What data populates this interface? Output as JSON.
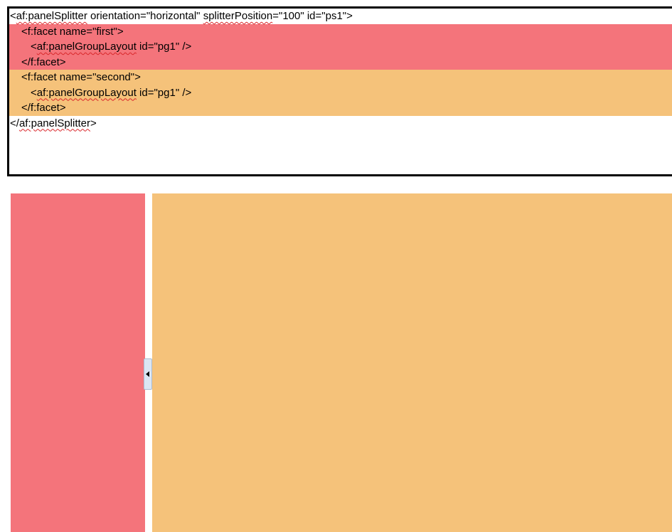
{
  "code": {
    "line1": {
      "prefix": "<",
      "tag": "af:panelSplitter",
      "middle": " orientation=\"horizontal\" ",
      "attr": "splitterPosition",
      "suffix": "=\"100\" id=\"ps1\">"
    },
    "line2": "<f:facet name=\"first\">",
    "line3": {
      "prefix": "<",
      "tag": "af:panelGroupLayout",
      "suffix": " id=\"pg1\" />"
    },
    "line4": "</f:facet>",
    "line5": "<f:facet name=\"second\">",
    "line6": {
      "prefix": "<",
      "tag": "af:panelGroupLayout",
      "suffix": " id=\"pg1\" />"
    },
    "line7": "</f:facet>",
    "line8": {
      "prefix": "</",
      "tag": "af:panelSplitter",
      "suffix": ">"
    }
  },
  "colors": {
    "first_facet": "#f4747b",
    "second_facet": "#f5c27a",
    "splitter_handle": "#dbe6f3"
  },
  "splitter": {
    "orientation": "horizontal",
    "handle_icon": "collapse-left-arrow-icon"
  }
}
